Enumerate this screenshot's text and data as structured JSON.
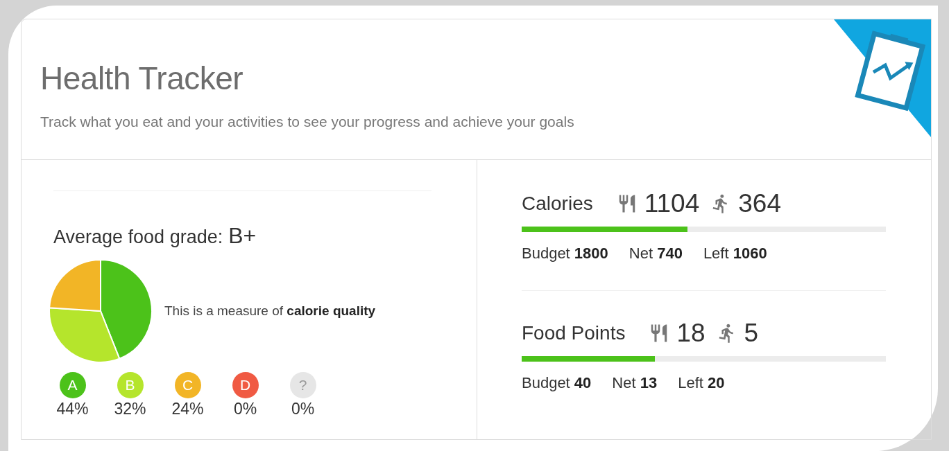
{
  "header": {
    "title": "Health Tracker",
    "subtitle": "Track what you eat and your activities to see your progress and achieve your goals"
  },
  "grade": {
    "label": "Average food grade:",
    "value": "B+",
    "note": "This is a measure of **calorie quality**",
    "chart_data": {
      "type": "pie",
      "values": [
        44,
        32,
        24,
        0,
        0
      ]
    },
    "items": [
      {
        "letter": "A",
        "percent": "44%",
        "color": "#4cc21a"
      },
      {
        "letter": "B",
        "percent": "32%",
        "color": "#b5e52c"
      },
      {
        "letter": "C",
        "percent": "24%",
        "color": "#f2b526"
      },
      {
        "letter": "D",
        "percent": "0%",
        "color": "#f05a43"
      },
      {
        "letter": "?",
        "percent": "0%",
        "color": "#e6e6e6"
      }
    ]
  },
  "stats": [
    {
      "title": "Calories",
      "food": "1104",
      "exercise": "364",
      "level": 0.455,
      "figures": [
        "Budget **1800**",
        "Net **740**",
        "Left **1060**"
      ]
    },
    {
      "title": "Food Points",
      "food": "18",
      "exercise": "5",
      "level": 0.366,
      "figures": [
        "Budget **40**",
        "Net **13**",
        "Left **20**"
      ]
    }
  ]
}
